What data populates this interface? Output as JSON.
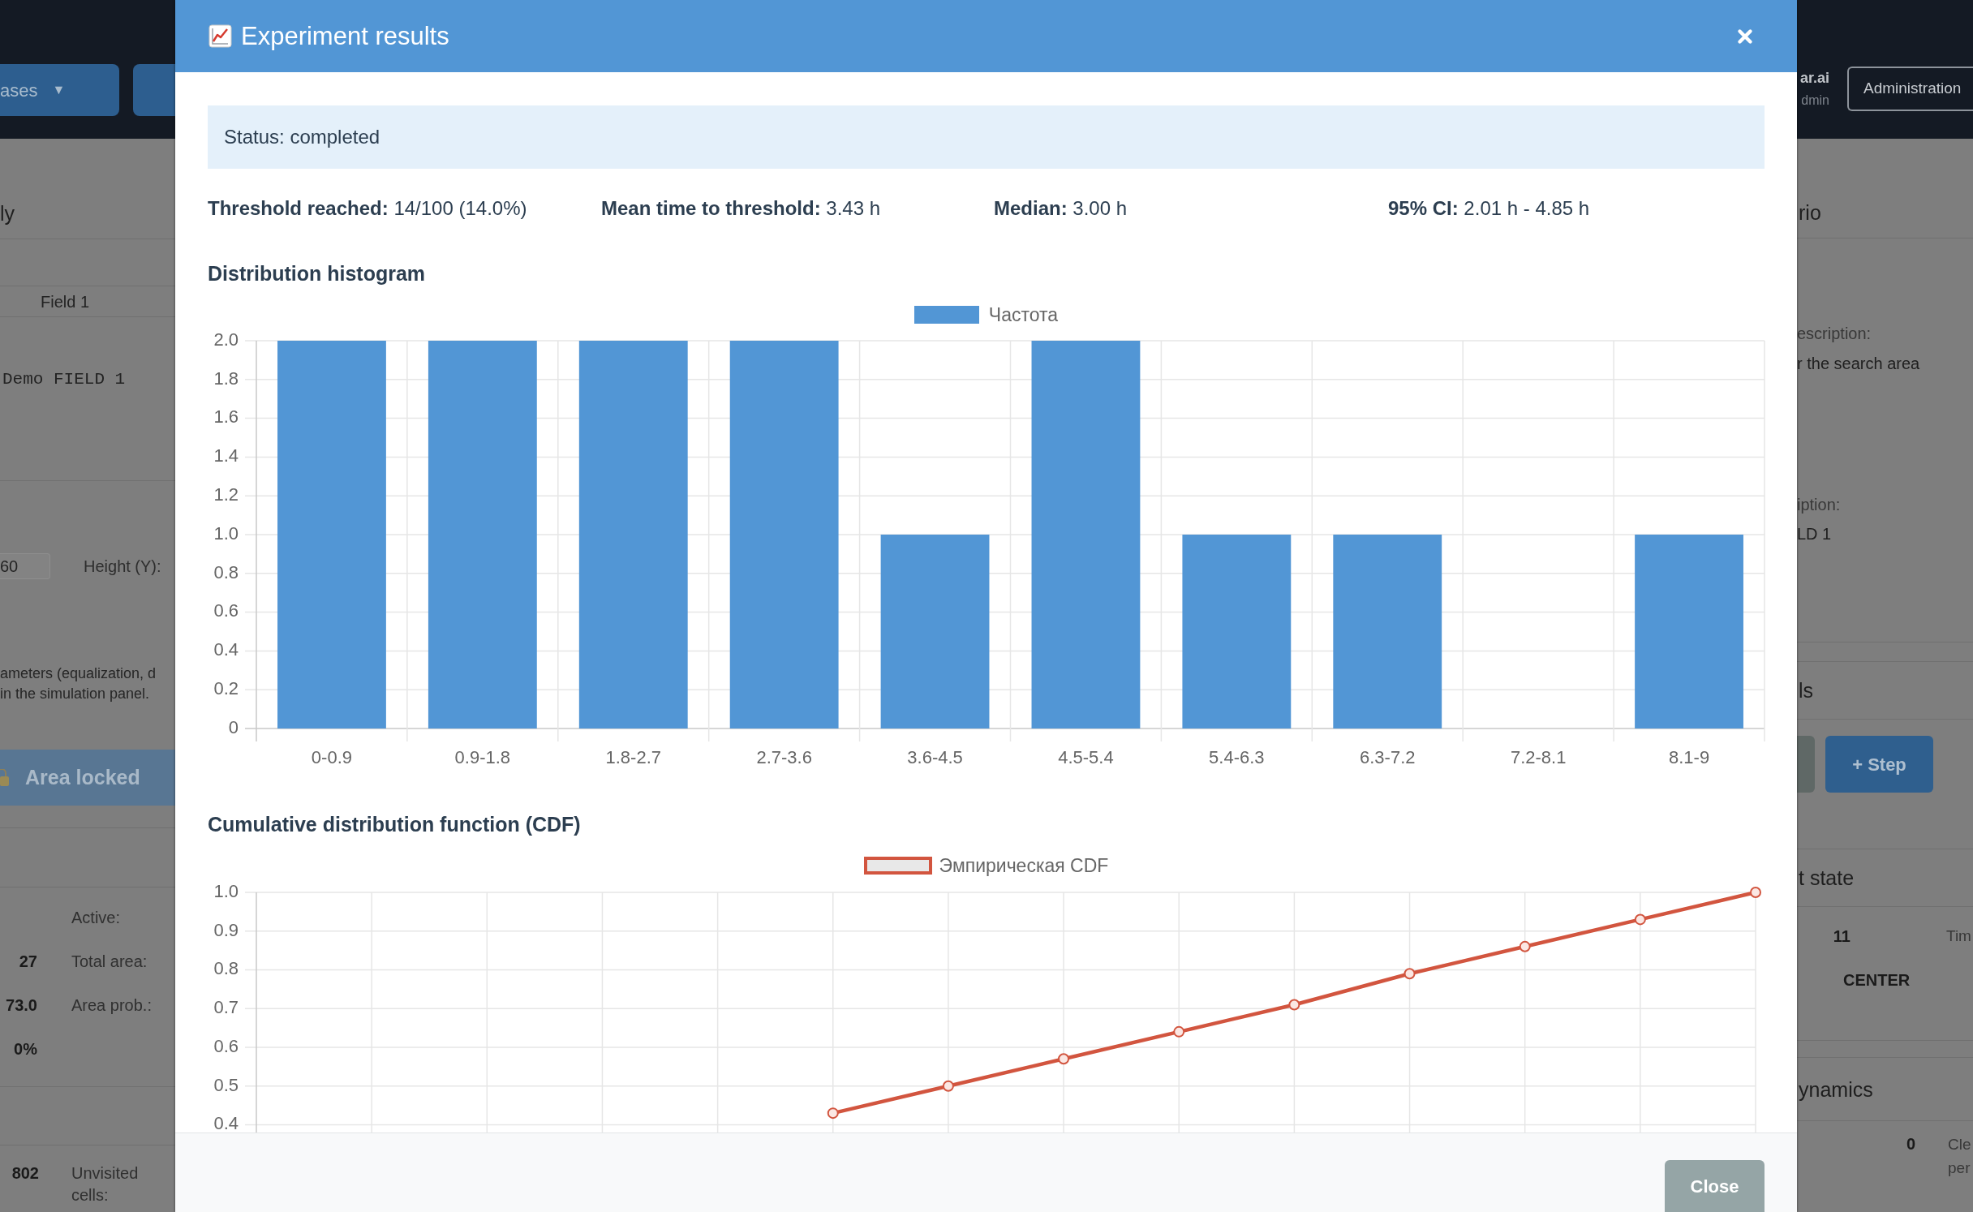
{
  "navbar": {
    "menu_button": {
      "label": "ases",
      "caret": "▼"
    },
    "user": {
      "name": "ar.ai",
      "role": "dmin"
    },
    "admin_button": "Administration"
  },
  "left_panel": {
    "heading": "ly",
    "field_name": "Field 1",
    "field_code": "Demo FIELD 1",
    "width_input": "60",
    "height_label": "Height (Y):",
    "note_lines": [
      "ameters (equalization, d",
      "in the simulation panel."
    ],
    "lock_button": "Area locked",
    "stats": [
      {
        "label": "Active:"
      },
      {
        "value": "27",
        "label": "Total area:"
      },
      {
        "value": "73.0",
        "label": "Area prob.:"
      },
      {
        "value": "0%"
      }
    ],
    "unvisited": {
      "value": "802",
      "label": "Unvisited cells:"
    }
  },
  "modal": {
    "title": "Experiment results",
    "status": "Status: completed",
    "stats": [
      "**Threshold reached:** 14/100 (14.0%)",
      "**Mean time to threshold:** 3.43 h",
      "**Median:** 3.00 h",
      "**95% CI:** 2.01 h - 4.85 h"
    ],
    "histogram": {
      "chart_data": {
        "type": "bar",
        "title": "Distribution histogram",
        "categories": [
          "0-0.9",
          "0.9-1.8",
          "1.8-2.7",
          "2.7-3.6",
          "3.6-4.5",
          "4.5-5.4",
          "5.4-6.3",
          "6.3-7.2",
          "7.2-8.1",
          "8.1-9"
        ],
        "series": [
          {
            "name": "Частота",
            "color": "#5296d5",
            "values": [
              2,
              2,
              2,
              2,
              1,
              2,
              1,
              1,
              0,
              1
            ]
          }
        ],
        "ylim": [
          0,
          2
        ],
        "yticks": [
          0,
          0.2,
          0.4,
          0.6,
          0.8,
          {
            "value": 1,
            "label": "1.0"
          },
          1.2,
          1.4,
          1.6,
          1.8,
          {
            "value": 2,
            "label": "2.0"
          }
        ],
        "grid": true
      }
    },
    "cdf": {
      "chart_data": {
        "type": "line",
        "title": "Cumulative distribution function (CDF)",
        "series": [
          {
            "name": "Эмпирическая CDF",
            "color": "#d2553f",
            "marker": "circle",
            "values": [
              null,
              null,
              null,
              null,
              null,
              0.43,
              0.5,
              0.57,
              0.64,
              0.71,
              0.79,
              0.86,
              0.93,
              1
            ]
          }
        ],
        "ylim": [
          0.38,
          1
        ],
        "yticks": [
          0.4,
          0.5,
          0.6,
          0.7,
          0.8,
          0.9,
          {
            "value": 1,
            "label": "1.0"
          }
        ],
        "grid": true
      }
    },
    "close_button": "Close"
  },
  "right_panel": {
    "heading": "rio",
    "description_label": "escription:",
    "description": "r the search area",
    "field_label": "iption:",
    "field_value": "LD 1",
    "controls_heading": "ls",
    "step_button": "+ Step",
    "state_heading": "t state",
    "state_row": {
      "value": "11",
      "label": "Tim"
    },
    "state_position": "CENTER",
    "dynamics_heading": "ynamics",
    "dynamics_row": {
      "value": "0",
      "label_lines": [
        "Cle",
        "per"
      ]
    }
  }
}
